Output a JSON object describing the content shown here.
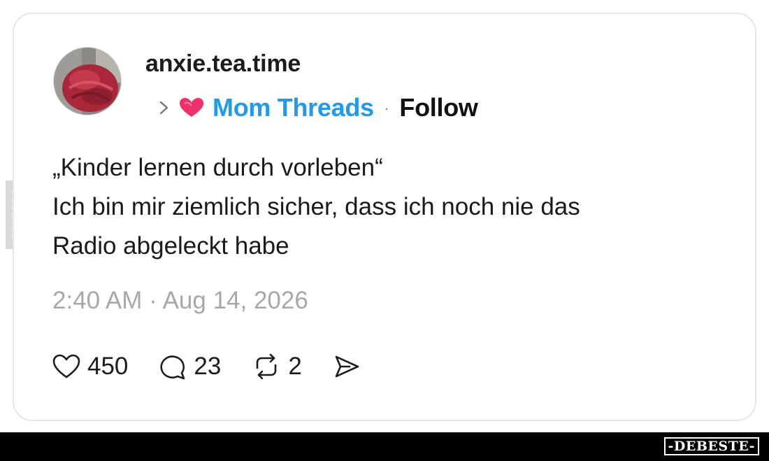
{
  "post": {
    "username": "anxie.tea.time",
    "community": {
      "name": "Mom Threads",
      "separator": "·",
      "follow_label": "Follow",
      "icon": "heart-icon",
      "color": "#1d9bf0",
      "icon_color": "#f0306a"
    },
    "text_lines": [
      "„Kinder lernen durch vorleben“",
      "Ich bin mir ziemlich sicher, dass ich noch nie das",
      "Radio abgeleckt habe"
    ],
    "timestamp": "2:40 AM · Aug 14, 2026",
    "actions": {
      "likes": "450",
      "replies": "23",
      "reposts": "2"
    }
  },
  "watermark": {
    "bottom": "-DEBESTE-",
    "side": "DEBESTE"
  }
}
